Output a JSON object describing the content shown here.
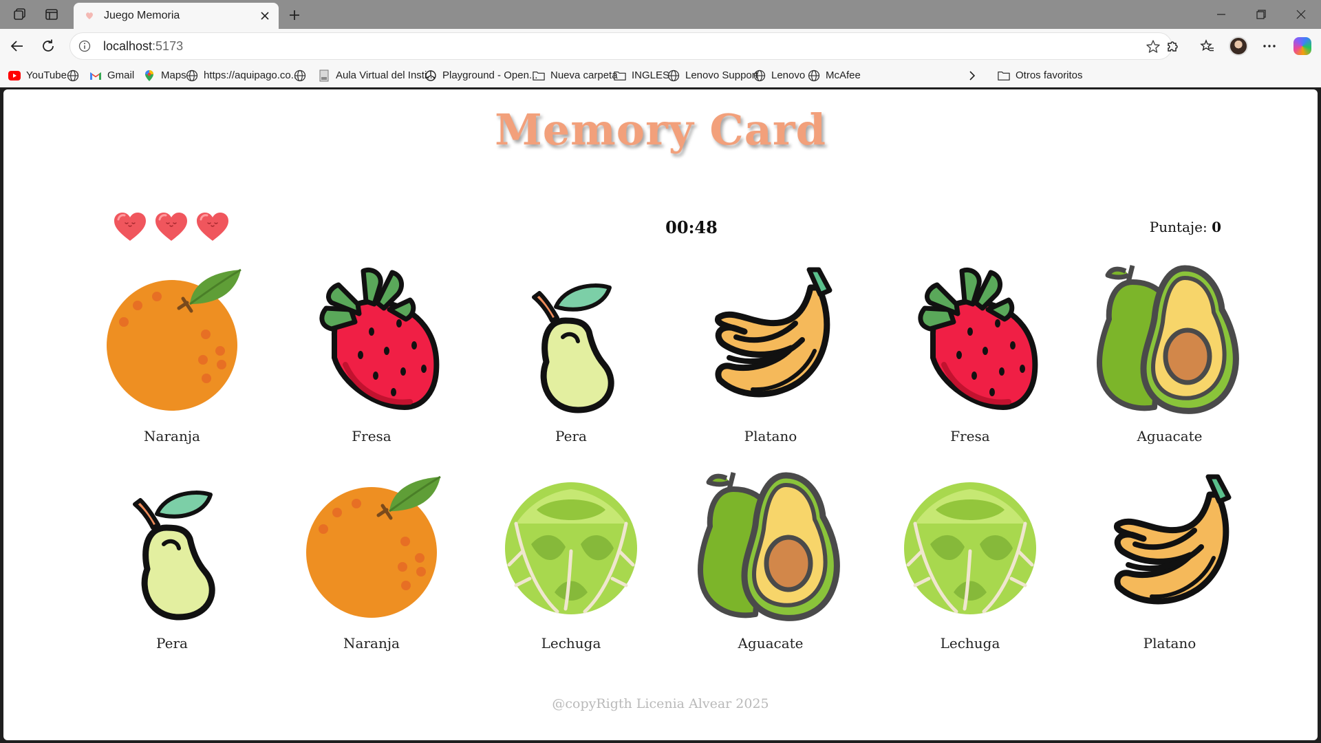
{
  "browser": {
    "tab_title": "Juego Memoria",
    "url_host": "localhost",
    "url_port": ":5173",
    "bookmarks": [
      {
        "label": "YouTube",
        "icon": "youtube-icon"
      },
      {
        "label": "",
        "icon": "globe-icon"
      },
      {
        "label": "Gmail",
        "icon": "gmail-icon"
      },
      {
        "label": "Maps",
        "icon": "maps-icon"
      },
      {
        "label": "https://aquipago.co...",
        "icon": "globe-icon"
      },
      {
        "label": "",
        "icon": "globe-icon"
      },
      {
        "label": "Aula Virtual del Insti...",
        "icon": "page-icon"
      },
      {
        "label": "Playground - Open...",
        "icon": "openai-icon"
      },
      {
        "label": "Nueva carpeta",
        "icon": "folder-icon"
      },
      {
        "label": "INGLES",
        "icon": "folder-icon"
      },
      {
        "label": "Lenovo Support",
        "icon": "globe-icon"
      },
      {
        "label": "Lenovo",
        "icon": "globe-icon"
      },
      {
        "label": "McAfee",
        "icon": "globe-icon"
      }
    ],
    "other_favorites": "Otros favoritos"
  },
  "game": {
    "title": "Memory Card",
    "lives": 3,
    "timer": "00:48",
    "score_label": "Puntaje:",
    "score_value": "0",
    "cards": [
      {
        "label": "Naranja",
        "fruit": "orange"
      },
      {
        "label": "Fresa",
        "fruit": "strawberry"
      },
      {
        "label": "Pera",
        "fruit": "pear"
      },
      {
        "label": "Platano",
        "fruit": "banana"
      },
      {
        "label": "Fresa",
        "fruit": "strawberry"
      },
      {
        "label": "Aguacate",
        "fruit": "avocado"
      },
      {
        "label": "Pera",
        "fruit": "pear"
      },
      {
        "label": "Naranja",
        "fruit": "orange"
      },
      {
        "label": "Lechuga",
        "fruit": "lettuce"
      },
      {
        "label": "Aguacate",
        "fruit": "avocado"
      },
      {
        "label": "Lechuga",
        "fruit": "lettuce"
      },
      {
        "label": "Platano",
        "fruit": "banana"
      }
    ],
    "footer": "@copyRigth Licenia Alvear 2025"
  },
  "colors": {
    "title": "#f2a07b",
    "heart": "#f0565d",
    "orange": "#ee8f22",
    "strawberry": "#f01f45",
    "pear": "#e3efa0",
    "banana": "#f5b95a",
    "avocado_skin": "#7cb52a",
    "lettuce": "#a8d84e"
  }
}
